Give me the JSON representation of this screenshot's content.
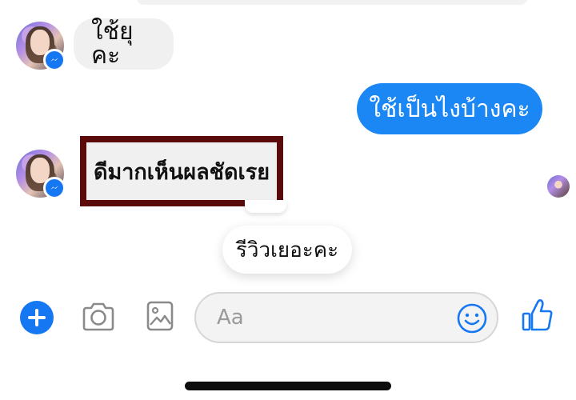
{
  "messages": {
    "incoming_1": "ใช้ยุคะ",
    "outgoing_1": "ใช้เป็นไงบ้างคะ",
    "incoming_2": "ดีมากเห็นผลชัดเรย",
    "floating": "รีวิวเยอะคะ"
  },
  "composer": {
    "placeholder": "Aa",
    "add_icon": "plus-circle-icon",
    "camera_icon": "camera-icon",
    "gallery_icon": "image-icon",
    "emoji_icon": "smiley-icon",
    "like_icon": "thumbs-up-icon"
  },
  "colors": {
    "accent": "#1a87f5",
    "incoming_bubble": "#f0f0f0",
    "highlight_border": "#5a0a0a"
  }
}
